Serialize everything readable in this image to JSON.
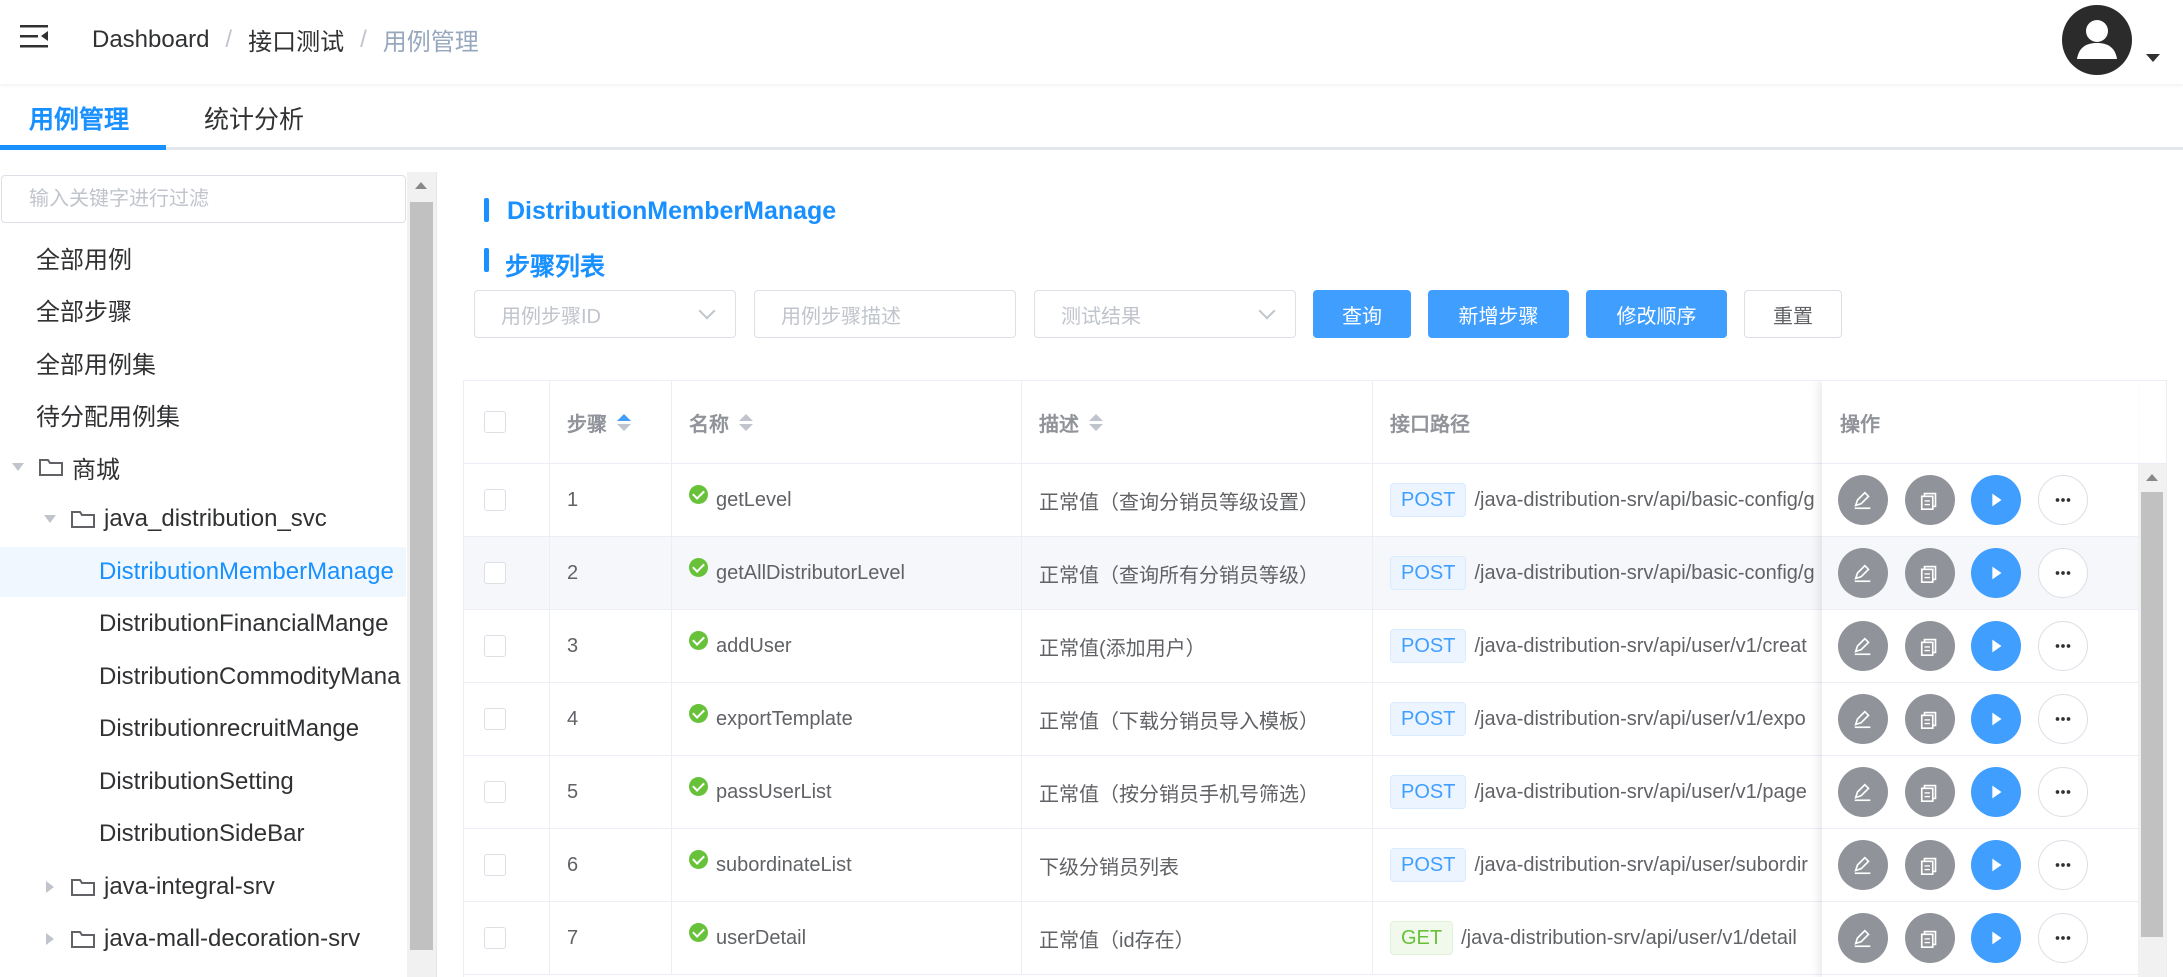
{
  "header": {
    "breadcrumb": [
      "Dashboard",
      "接口测试",
      "用例管理"
    ]
  },
  "tabs": [
    {
      "label": "用例管理",
      "active": true
    },
    {
      "label": "统计分析",
      "active": false
    }
  ],
  "sidebar": {
    "filter_placeholder": "输入关键字进行过滤",
    "items": [
      {
        "label": "全部用例"
      },
      {
        "label": "全部步骤"
      },
      {
        "label": "全部用例集"
      },
      {
        "label": "待分配用例集"
      },
      {
        "label": "商城",
        "folder": true,
        "expanded": true
      },
      {
        "label": "java_distribution_svc",
        "folder": true,
        "expanded": true
      },
      {
        "label": "DistributionMemberManage",
        "selected": true
      },
      {
        "label": "DistributionFinancialMange"
      },
      {
        "label": "DistributionCommodityMana"
      },
      {
        "label": "DistributionrecruitMange"
      },
      {
        "label": "DistributionSetting"
      },
      {
        "label": "DistributionSideBar"
      },
      {
        "label": "java-integral-srv",
        "folder": true,
        "expanded": false
      },
      {
        "label": "java-mall-decoration-srv",
        "folder": true,
        "expanded": false
      }
    ]
  },
  "main": {
    "title": "DistributionMemberManage",
    "subtitle": "步骤列表",
    "filters": {
      "step_id_placeholder": "用例步骤ID",
      "step_desc_placeholder": "用例步骤描述",
      "result_placeholder": "测试结果"
    },
    "buttons": {
      "query": "查询",
      "add_step": "新增步骤",
      "reorder": "修改顺序",
      "reset": "重置"
    }
  },
  "table": {
    "headers": {
      "step": "步骤",
      "name": "名称",
      "desc": "描述",
      "path": "接口路径",
      "ops": "操作"
    },
    "rows": [
      {
        "step": "1",
        "name": "getLevel",
        "desc": "正常值（查询分销员等级设置）",
        "method": "POST",
        "path": "/java-distribution-srv/api/basic-config/g"
      },
      {
        "step": "2",
        "name": "getAllDistributorLevel",
        "desc": "正常值（查询所有分销员等级）",
        "method": "POST",
        "path": "/java-distribution-srv/api/basic-config/g"
      },
      {
        "step": "3",
        "name": "addUser",
        "desc": "正常值(添加用户）",
        "method": "POST",
        "path": "/java-distribution-srv/api/user/v1/creat"
      },
      {
        "step": "4",
        "name": "exportTemplate",
        "desc": "正常值（下载分销员导入模板）",
        "method": "POST",
        "path": "/java-distribution-srv/api/user/v1/expo"
      },
      {
        "step": "5",
        "name": "passUserList",
        "desc": "正常值（按分销员手机号筛选）",
        "method": "POST",
        "path": "/java-distribution-srv/api/user/v1/page"
      },
      {
        "step": "6",
        "name": "subordinateList",
        "desc": "下级分销员列表",
        "method": "POST",
        "path": "/java-distribution-srv/api/user/subordir"
      },
      {
        "step": "7",
        "name": "userDetail",
        "desc": "正常值（id存在）",
        "method": "GET",
        "path": "/java-distribution-srv/api/user/v1/detail"
      }
    ]
  }
}
